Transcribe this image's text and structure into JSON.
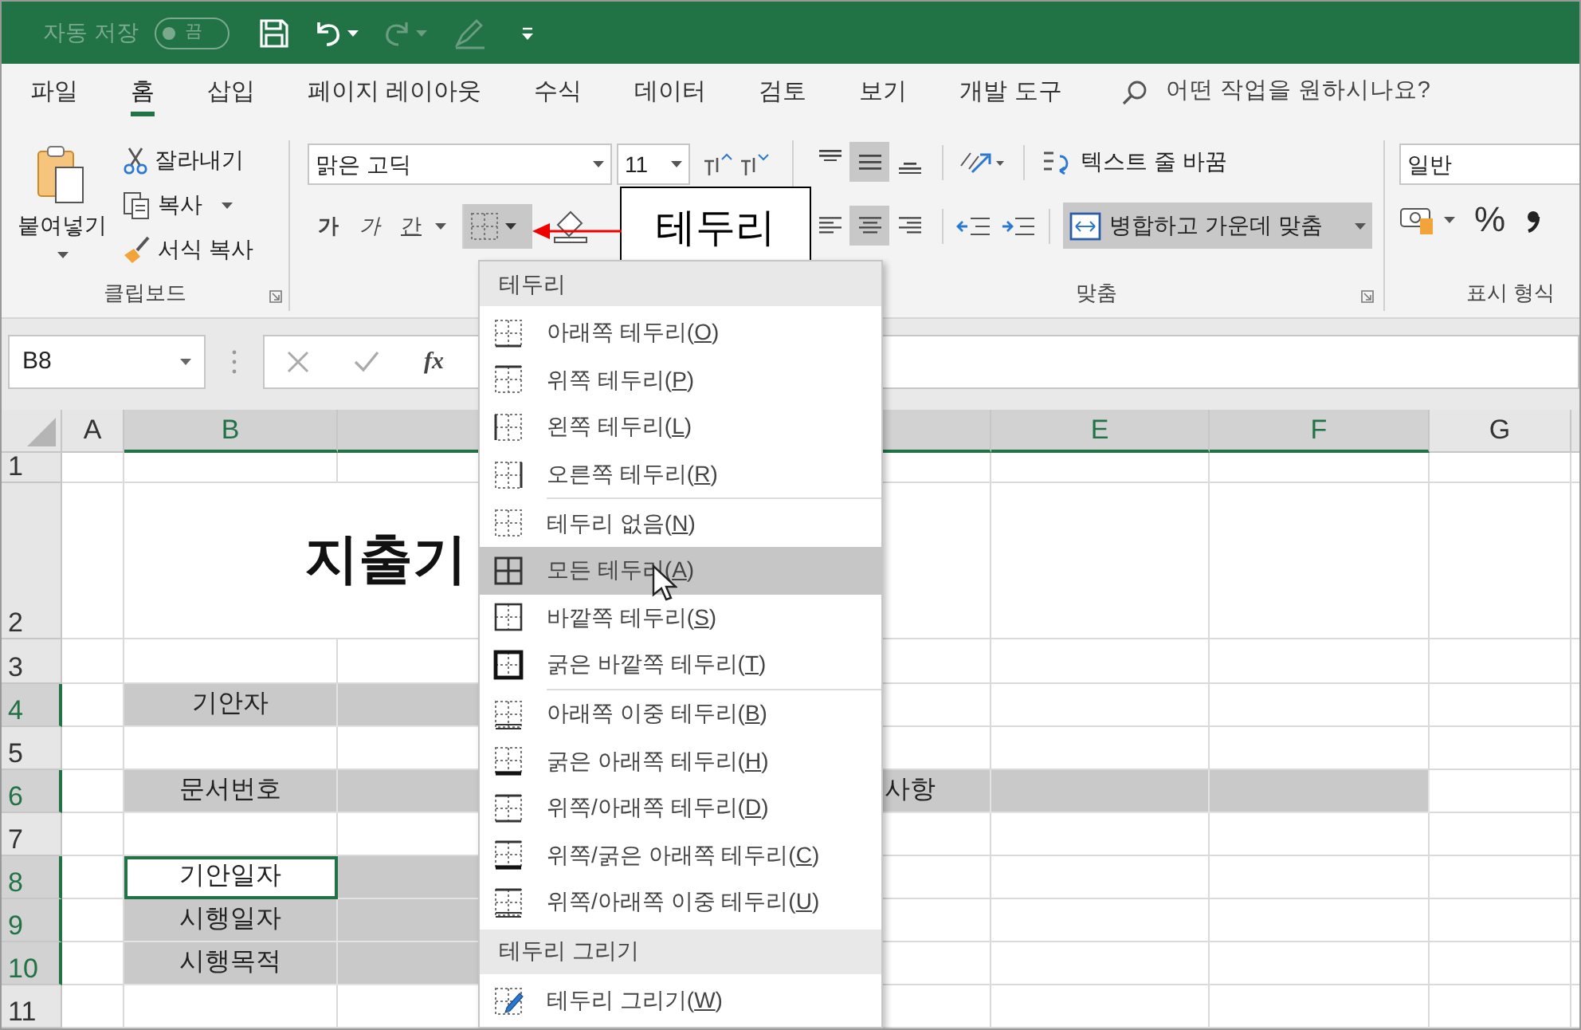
{
  "title_bar": {
    "autosave_label": "자동 저장",
    "autosave_toggle": {
      "label": "끔",
      "on": false
    }
  },
  "tabs": [
    {
      "label": "파일",
      "selected": false
    },
    {
      "label": "홈",
      "selected": true
    },
    {
      "label": "삽입",
      "selected": false
    },
    {
      "label": "페이지 레이아웃",
      "selected": false
    },
    {
      "label": "수식",
      "selected": false
    },
    {
      "label": "데이터",
      "selected": false
    },
    {
      "label": "검토",
      "selected": false
    },
    {
      "label": "보기",
      "selected": false
    },
    {
      "label": "개발 도구",
      "selected": false
    }
  ],
  "search": {
    "placeholder": "어떤 작업을 원하시나요?"
  },
  "ribbon": {
    "clipboard": {
      "paste": "붙여넣기",
      "cut": "잘라내기",
      "copy": "복사",
      "format_painter": "서식 복사",
      "label": "클립보드"
    },
    "font": {
      "font_name": "맑은 고딕",
      "font_size": "11",
      "bold": "가",
      "italic": "가",
      "underline": "간"
    },
    "alignment": {
      "vertical": [
        {
          "selected": false
        },
        {
          "selected": true
        },
        {
          "selected": false
        }
      ],
      "horizontal": [
        {
          "selected": false
        },
        {
          "selected": true
        },
        {
          "selected": false
        }
      ],
      "wrap_text": "텍스트 줄 바꿈",
      "merge_center": "병합하고 가운데 맞춤",
      "label": "맞춤"
    },
    "number": {
      "format": "일반",
      "percent": "%",
      "label": "표시 형식"
    }
  },
  "callout": "테두리",
  "border_menu": {
    "sections": [
      {
        "header": "테두리",
        "groups": [
          [
            {
              "label": "아래쪽 테두리",
              "shortcut": "(O)",
              "selected": false
            },
            {
              "label": "위쪽 테두리",
              "shortcut": "(P)",
              "selected": false
            },
            {
              "label": "왼쪽 테두리",
              "shortcut": "(L)",
              "selected": false
            },
            {
              "label": "오른쪽 테두리",
              "shortcut": "(R)",
              "selected": false
            }
          ],
          [
            {
              "label": "테두리 없음",
              "shortcut": "(N)",
              "selected": false
            },
            {
              "label": "모든 테두리",
              "shortcut": "(A)",
              "selected": true
            },
            {
              "label": "바깥쪽 테두리",
              "shortcut": "(S)",
              "selected": false
            },
            {
              "label": "굵은 바깥쪽 테두리",
              "shortcut": "(T)",
              "selected": false
            }
          ],
          [
            {
              "label": "아래쪽 이중 테두리",
              "shortcut": "(B)",
              "selected": false
            },
            {
              "label": "굵은 아래쪽 테두리",
              "shortcut": "(H)",
              "selected": false
            },
            {
              "label": "위쪽/아래쪽 테두리",
              "shortcut": "(D)",
              "selected": false
            },
            {
              "label": "위쪽/굵은 아래쪽 테두리",
              "shortcut": "(C)",
              "selected": false
            },
            {
              "label": "위쪽/아래쪽 이중 테두리",
              "shortcut": "(U)",
              "selected": false
            }
          ]
        ]
      },
      {
        "header": "테두리 그리기",
        "groups": [
          [
            {
              "label": "테두리 그리기",
              "shortcut": "(W)",
              "selected": false
            }
          ]
        ]
      }
    ]
  },
  "formula_bar": {
    "name_box": "B8",
    "insert_function": "fx"
  },
  "sheet": {
    "columns": [
      {
        "label": "A",
        "selected": false
      },
      {
        "label": "B",
        "selected": true
      },
      {
        "selected": true
      },
      {
        "selected": true
      },
      {
        "label": "E",
        "selected": true
      },
      {
        "label": "F",
        "selected": true
      },
      {
        "label": "G",
        "selected": false
      }
    ],
    "rows": [
      {
        "number": "1",
        "selected": false,
        "cells": [
          {
            "shaded": false,
            "selected": false
          },
          {
            "shaded": false,
            "selected": false
          },
          {
            "shaded": false,
            "selected": false
          },
          {
            "shaded": false,
            "selected": false
          },
          {
            "shaded": false,
            "selected": false
          },
          {
            "shaded": false,
            "selected": false
          },
          {
            "shaded": false,
            "selected": false
          }
        ]
      },
      {
        "number": "2",
        "selected": false,
        "cells": [
          {
            "shaded": false,
            "selected": false
          },
          {
            "kind": "title",
            "text": "지출기",
            "shaded": false,
            "selected": false
          },
          {
            "shaded": false,
            "selected": false
          },
          {
            "shaded": false,
            "selected": false
          },
          {
            "shaded": false,
            "selected": false
          },
          {
            "shaded": false,
            "selected": false
          }
        ]
      },
      {
        "number": "3",
        "selected": false,
        "cells": [
          {
            "shaded": false,
            "selected": false
          },
          {
            "shaded": false,
            "selected": false
          },
          {
            "shaded": false,
            "selected": false
          },
          {
            "shaded": false,
            "selected": false
          },
          {
            "shaded": false,
            "selected": false
          },
          {
            "shaded": false,
            "selected": false
          },
          {
            "shaded": false,
            "selected": false
          }
        ]
      },
      {
        "number": "4",
        "selected": true,
        "cells": [
          {
            "shaded": false,
            "selected": false
          },
          {
            "text": "기안자",
            "shaded": true,
            "selected": false
          },
          {
            "shaded": true,
            "selected": false
          },
          {
            "shaded": false,
            "selected": false
          },
          {
            "shaded": false,
            "selected": false
          },
          {
            "shaded": false,
            "selected": false
          },
          {
            "shaded": false,
            "selected": false
          }
        ]
      },
      {
        "number": "5",
        "selected": false,
        "cells": [
          {
            "shaded": false,
            "selected": false
          },
          {
            "shaded": false,
            "selected": false
          },
          {
            "shaded": false,
            "selected": false
          },
          {
            "shaded": false,
            "selected": false
          },
          {
            "shaded": false,
            "selected": false
          },
          {
            "shaded": false,
            "selected": false
          },
          {
            "shaded": false,
            "selected": false
          }
        ]
      },
      {
        "number": "6",
        "selected": true,
        "cells": [
          {
            "shaded": false,
            "selected": false
          },
          {
            "text": "문서번호",
            "shaded": true,
            "selected": false
          },
          {
            "shaded": true,
            "selected": false
          },
          {
            "kind": "clipped",
            "text": "사항",
            "shaded": true,
            "selected": false
          },
          {
            "shaded": true,
            "selected": false
          },
          {
            "shaded": true,
            "selected": false
          },
          {
            "shaded": false,
            "selected": false
          }
        ]
      },
      {
        "number": "7",
        "selected": false,
        "cells": [
          {
            "shaded": false,
            "selected": false
          },
          {
            "shaded": false,
            "selected": false
          },
          {
            "shaded": false,
            "selected": false
          },
          {
            "shaded": false,
            "selected": false
          },
          {
            "shaded": false,
            "selected": false
          },
          {
            "shaded": false,
            "selected": false
          },
          {
            "shaded": false,
            "selected": false
          }
        ]
      },
      {
        "number": "8",
        "selected": true,
        "cells": [
          {
            "shaded": false,
            "selected": false
          },
          {
            "text": "기안일자",
            "shaded": false,
            "selected": true
          },
          {
            "shaded": true,
            "selected": false
          },
          {
            "shaded": false,
            "selected": false
          },
          {
            "shaded": false,
            "selected": false
          },
          {
            "shaded": false,
            "selected": false
          },
          {
            "shaded": false,
            "selected": false
          }
        ]
      },
      {
        "number": "9",
        "selected": true,
        "cells": [
          {
            "shaded": false,
            "selected": false
          },
          {
            "text": "시행일자",
            "shaded": true,
            "selected": false
          },
          {
            "shaded": true,
            "selected": false
          },
          {
            "shaded": false,
            "selected": false
          },
          {
            "shaded": false,
            "selected": false
          },
          {
            "shaded": false,
            "selected": false
          },
          {
            "shaded": false,
            "selected": false
          }
        ]
      },
      {
        "number": "10",
        "selected": true,
        "cells": [
          {
            "shaded": false,
            "selected": false
          },
          {
            "text": "시행목적",
            "shaded": true,
            "selected": false
          },
          {
            "shaded": true,
            "selected": false
          },
          {
            "shaded": false,
            "selected": false
          },
          {
            "shaded": false,
            "selected": false
          },
          {
            "shaded": false,
            "selected": false
          },
          {
            "shaded": false,
            "selected": false
          }
        ]
      },
      {
        "number": "11",
        "selected": false,
        "cells": [
          {
            "shaded": false,
            "selected": false
          },
          {
            "shaded": false,
            "selected": false
          },
          {
            "shaded": false,
            "selected": false
          },
          {
            "shaded": false,
            "selected": false
          },
          {
            "shaded": false,
            "selected": false
          },
          {
            "shaded": false,
            "selected": false
          },
          {
            "shaded": false,
            "selected": false
          }
        ]
      }
    ]
  }
}
